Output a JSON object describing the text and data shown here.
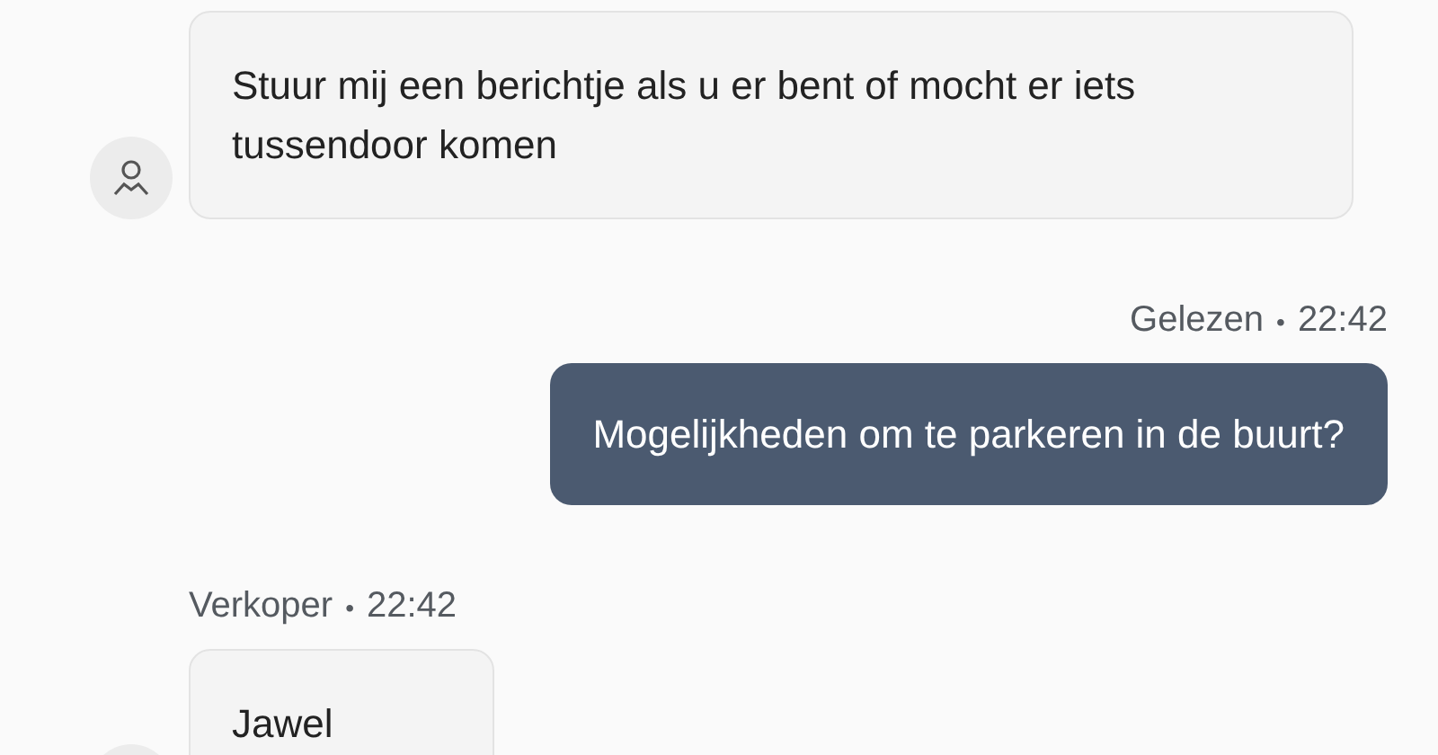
{
  "messages": [
    {
      "kind": "incoming",
      "text": "Stuur mij een berichtje als u er bent of mocht er iets tussendoor komen"
    },
    {
      "kind": "outgoing",
      "meta": {
        "label": "Gelezen",
        "separator": "•",
        "time": "22:42"
      },
      "text": "Mogelijkheden om te parkeren in de buurt?"
    },
    {
      "kind": "incoming",
      "meta": {
        "label": "Verkoper",
        "separator": "•",
        "time": "22:42"
      },
      "text": "Jawel"
    }
  ]
}
